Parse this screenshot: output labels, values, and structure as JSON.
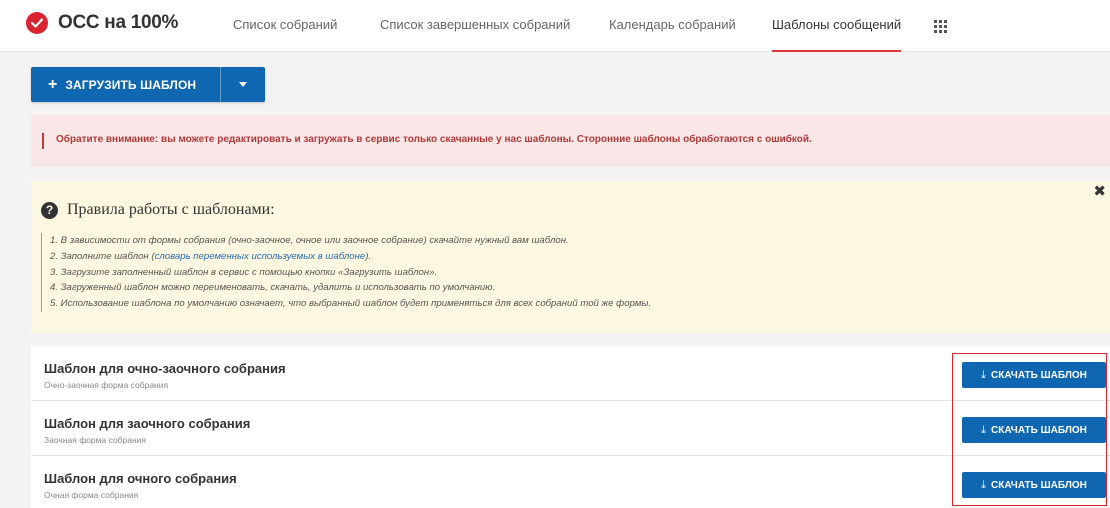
{
  "app": {
    "logo_text": "ОСС на 100%"
  },
  "nav": {
    "items": [
      {
        "label": "Список собраний"
      },
      {
        "label": "Список завершенных собраний"
      },
      {
        "label": "Календарь собраний"
      },
      {
        "label": "Шаблоны сообщений",
        "active": true
      }
    ],
    "apps_icon": "grid-icon"
  },
  "toolbar": {
    "upload_label": "ЗАГРУЗИТЬ ШАБЛОН",
    "upload_icon": "plus-icon"
  },
  "notice": {
    "text": "Обратите внимание: вы можете редактировать и загружать в сервис только скачанные у нас шаблоны. Сторонние шаблоны обработаются с ошибкой."
  },
  "rules": {
    "title": "Правила работы с шаблонами:",
    "close": "✖",
    "items": [
      "1. В зависимости от формы собрания (очно-заочное, очное или заочное собрание) скачайте нужный вам шаблон.",
      "2. Заполните шаблон (",
      "словарь переменных используемых в шаблоне",
      ").",
      "3. Загрузите заполненный шаблон в сервис с помощью кнопки «Загрузить шаблон».",
      "4. Загруженный шаблон можно переименовать, скачать, удалить и использовать по умолчанию.",
      "5. Использование шаблона по умолчанию означает, что выбранный шаблон будет применяться для всех собраний той же формы."
    ]
  },
  "templates": [
    {
      "title": "Шаблон для очно-заочного собрания",
      "subtitle": "Очно-заочная форма собрания",
      "button": "СКАЧАТЬ ШАБЛОН"
    },
    {
      "title": "Шаблон для заочного собрания",
      "subtitle": "Заочная форма собрания",
      "button": "СКАЧАТЬ ШАБЛОН"
    },
    {
      "title": "Шаблон для очного собрания",
      "subtitle": "Очная форма собрания",
      "button": "СКАЧАТЬ ШАБЛОН"
    }
  ],
  "colors": {
    "brand_red": "#d9232e",
    "primary_blue": "#0f67b1",
    "notice_bg": "#f9e7e7",
    "rules_bg": "#fcf7e1"
  }
}
